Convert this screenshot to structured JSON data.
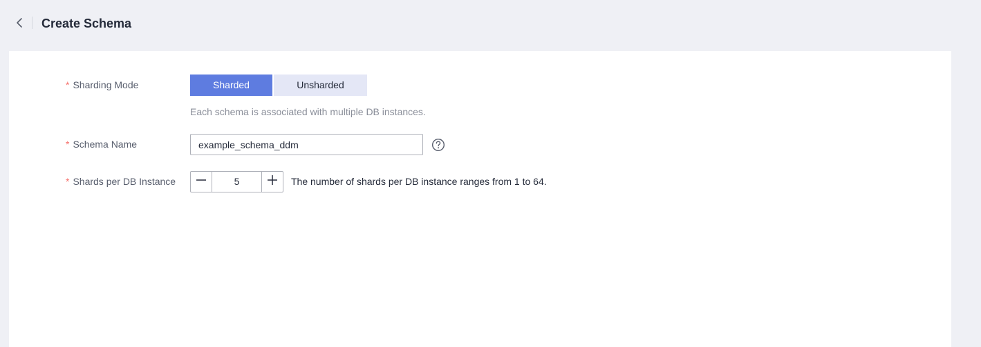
{
  "header": {
    "title": "Create Schema",
    "back_icon": "chevron-left-icon"
  },
  "form": {
    "sharding_mode": {
      "required_mark": "*",
      "label": "Sharding Mode",
      "options": [
        "Sharded",
        "Unsharded"
      ],
      "selected": "Sharded",
      "hint": "Each schema is associated with multiple DB instances."
    },
    "schema_name": {
      "required_mark": "*",
      "label": "Schema Name",
      "value": "example_schema_ddm",
      "help_icon": "question-circle-icon"
    },
    "shards_per_instance": {
      "required_mark": "*",
      "label": "Shards per DB Instance",
      "value": "5",
      "hint": "The number of shards per DB instance ranges from 1 to 64."
    }
  },
  "colors": {
    "accent": "#5e7ce0",
    "required": "#f66f6a",
    "background": "#eff0f5"
  }
}
